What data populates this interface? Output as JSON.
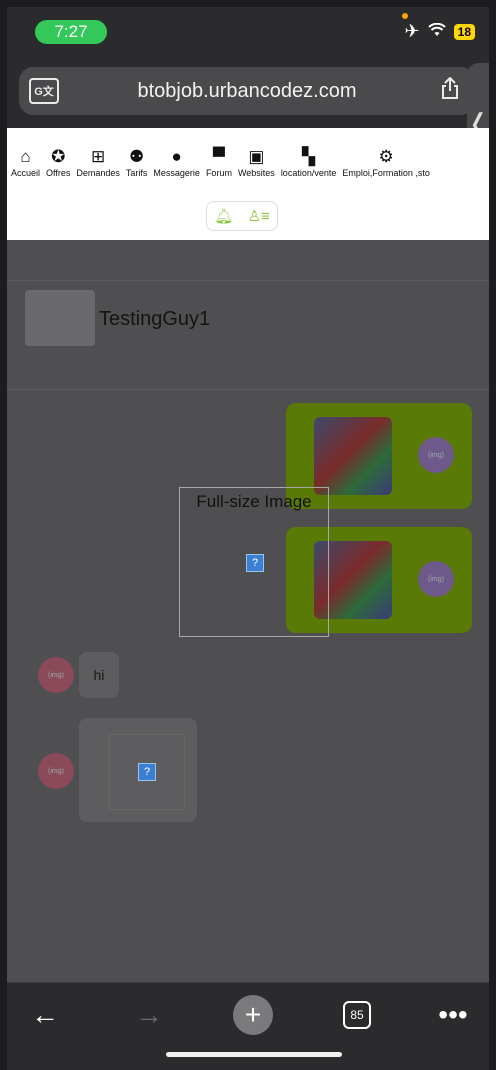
{
  "status_bar": {
    "time": "7:27",
    "battery": "18"
  },
  "browser": {
    "url": "btobjob.urbancodez.com"
  },
  "site_nav": {
    "items": [
      {
        "label": "Accueil",
        "icon": "home-icon"
      },
      {
        "label": "Offres",
        "icon": "offer-badge-icon"
      },
      {
        "label": "Demandes",
        "icon": "request-plus-icon"
      },
      {
        "label": "Tarifs",
        "icon": "user-plus-icon"
      },
      {
        "label": "Messagerie",
        "icon": "message-icon"
      },
      {
        "label": "Forum",
        "icon": "forum-icon"
      },
      {
        "label": "Websites",
        "icon": "website-icon"
      },
      {
        "label": "location/vente",
        "icon": "grid-icon"
      },
      {
        "label": "Emploi,Formation ,sto",
        "icon": "gears-icon"
      }
    ]
  },
  "chat": {
    "contact_name": "TestingGuy1",
    "received_text": "hi",
    "image_placeholder": "?"
  },
  "modal": {
    "title": "Full-size Image",
    "placeholder": "?"
  },
  "toolbar": {
    "tab_count": "85"
  }
}
